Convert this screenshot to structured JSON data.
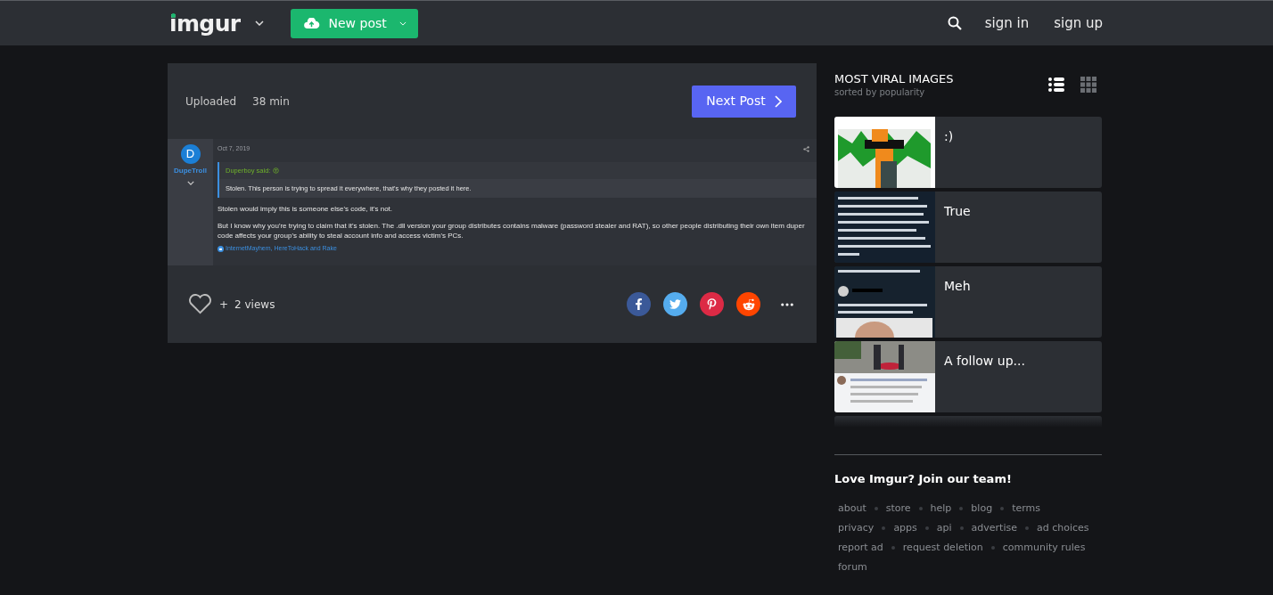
{
  "header": {
    "logo": "imgur",
    "new_post": "New post",
    "sign_in": "sign in",
    "sign_up": "sign up"
  },
  "post": {
    "uploaded_label": "Uploaded",
    "uploaded_time": "38 min",
    "next_button": "Next Post",
    "image": {
      "date": "Oct 7, 2019",
      "avatar_letter": "D",
      "author": "DupeTroll",
      "quote_author": "Duperboy said:",
      "quote": "Stolen. This person is trying to spread it everywhere, that's why they posted it here.",
      "paragraphs": [
        "Stolen would imply this is someone else's code, it's not.",
        "But I know why you're trying to claim that it's stolen. The .dll version your group distributes contains malware (password stealer and RAT), so other people distributing their own item duper code affects your group's ability to steal account info and access victim's PCs."
      ],
      "reactions": "InternetMayhem, HereToHack and Rake"
    },
    "plus": "+",
    "views": "2 views"
  },
  "sidebar": {
    "title": "MOST VIRAL IMAGES",
    "subtitle": "sorted by popularity",
    "view_modes": [
      {
        "kind": "list",
        "selected": true
      },
      {
        "kind": "grid",
        "selected": false
      }
    ],
    "items": [
      {
        "title": ":)"
      },
      {
        "title": "True"
      },
      {
        "title": "Meh"
      },
      {
        "title": "A follow up..."
      }
    ],
    "footer_heading": "Love Imgur? Join our team!",
    "link_rows": [
      [
        "about",
        "store",
        "help",
        "blog",
        "terms"
      ],
      [
        "privacy",
        "apps",
        "api",
        "advertise",
        "ad choices"
      ],
      [
        "report ad",
        "request deletion",
        "community rules"
      ],
      [
        "forum"
      ]
    ]
  }
}
